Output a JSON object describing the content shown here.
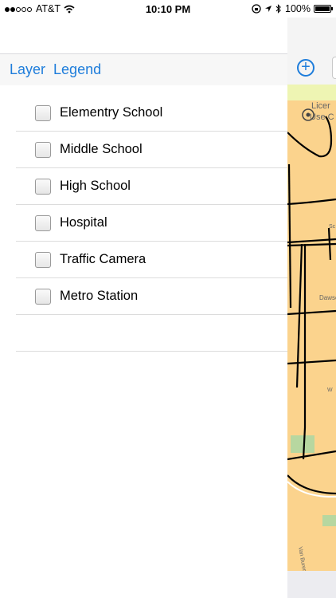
{
  "status_bar": {
    "carrier": "AT&T",
    "time": "10:10 PM",
    "battery": "100%"
  },
  "tabs": {
    "layer": "Layer",
    "legend": "Legend"
  },
  "layers": [
    {
      "label": "Elementry School",
      "checked": false
    },
    {
      "label": "Middle School",
      "checked": false
    },
    {
      "label": "High School",
      "checked": false
    },
    {
      "label": "Hospital",
      "checked": false
    },
    {
      "label": "Traffic Camera",
      "checked": false
    },
    {
      "label": "Metro Station",
      "checked": false
    }
  ],
  "map": {
    "licence_text": "Licer",
    "use_text": "Use C",
    "street_labels": [
      "Dawsc",
      "Van Buren St",
      "Sc",
      "W"
    ],
    "colors": {
      "land": "#fbd38d",
      "park": "#b7d7a0",
      "road": "#000000",
      "banner": "#eef5b3",
      "accent": "#1e7ddb"
    }
  }
}
